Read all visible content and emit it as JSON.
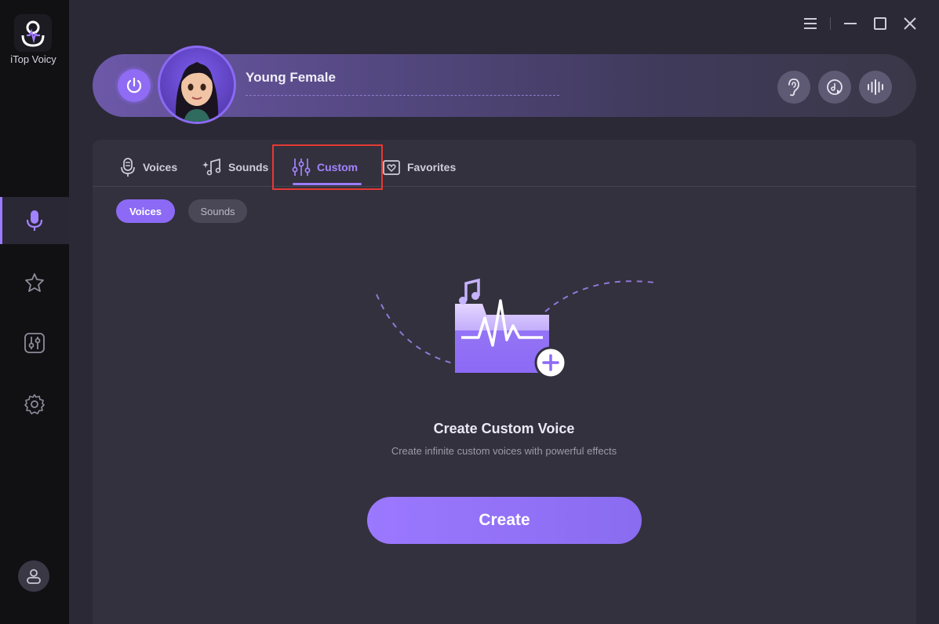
{
  "app": {
    "name": "iTop Voicy"
  },
  "header": {
    "voice_name": "Young Female"
  },
  "tabs": [
    {
      "label": "Voices"
    },
    {
      "label": "Sounds"
    },
    {
      "label": "Custom"
    },
    {
      "label": "Favorites"
    }
  ],
  "subtabs": [
    {
      "label": "Voices"
    },
    {
      "label": "Sounds"
    }
  ],
  "empty_state": {
    "title": "Create Custom Voice",
    "subtitle": "Create infinite custom voices with powerful effects",
    "button": "Create"
  },
  "colors": {
    "accent": "#9b7bff",
    "sidebar": "#111114",
    "panel": "#33313d",
    "highlight": "#e53935"
  }
}
